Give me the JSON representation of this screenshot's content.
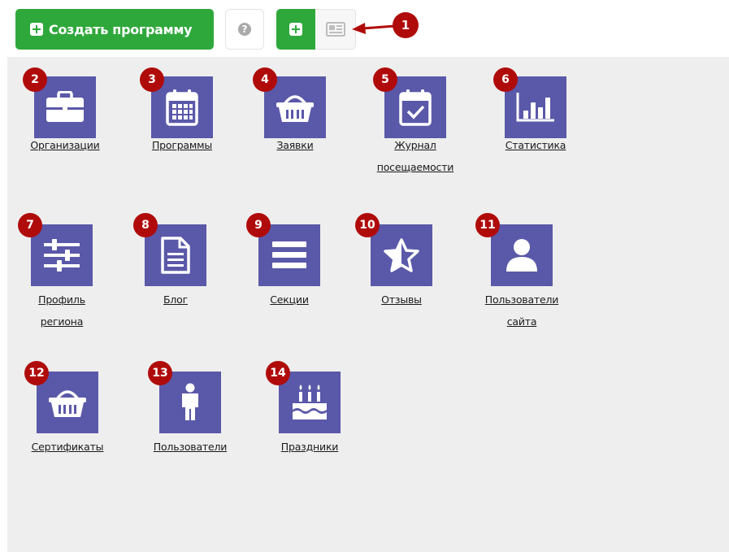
{
  "toolbar": {
    "create_button_label": "Создать программу",
    "help_icon_glyph": "?",
    "annotation_badge": "1",
    "icons": {
      "create": "plus-square-icon",
      "help": "question-circle-icon",
      "add": "plus-square-icon",
      "view": "newspaper-icon"
    }
  },
  "colors": {
    "accent_green": "#2fa83b",
    "tile_purple": "#5a58a8",
    "badge_red": "#b00b0b",
    "background": "#eeeeee"
  },
  "tiles": [
    {
      "badge": "2",
      "label_line1": "Организации",
      "label_line2": "",
      "icon": "briefcase-icon"
    },
    {
      "badge": "3",
      "label_line1": "Программы",
      "label_line2": "",
      "icon": "calendar-icon"
    },
    {
      "badge": "4",
      "label_line1": "Заявки",
      "label_line2": "",
      "icon": "basket-icon"
    },
    {
      "badge": "5",
      "label_line1": "Журнал",
      "label_line2": "посещаемости",
      "icon": "calendar-check-icon"
    },
    {
      "badge": "6",
      "label_line1": "Статистика",
      "label_line2": "",
      "icon": "bar-chart-icon"
    },
    {
      "badge": "7",
      "label_line1": "Профиль",
      "label_line2": "региона",
      "icon": "sliders-icon"
    },
    {
      "badge": "8",
      "label_line1": "Блог",
      "label_line2": "",
      "icon": "document-icon"
    },
    {
      "badge": "9",
      "label_line1": "Секции",
      "label_line2": "",
      "icon": "list-icon"
    },
    {
      "badge": "10",
      "label_line1": "Отзывы",
      "label_line2": "",
      "icon": "star-half-icon"
    },
    {
      "badge": "11",
      "label_line1": "Пользователи",
      "label_line2": "сайта",
      "icon": "user-icon"
    },
    {
      "badge": "12",
      "label_line1": "Сертификаты",
      "label_line2": "",
      "icon": "basket-icon"
    },
    {
      "badge": "13",
      "label_line1": "Пользователи",
      "label_line2": "",
      "icon": "person-icon"
    },
    {
      "badge": "14",
      "label_line1": "Праздники",
      "label_line2": "",
      "icon": "birthday-cake-icon"
    }
  ]
}
